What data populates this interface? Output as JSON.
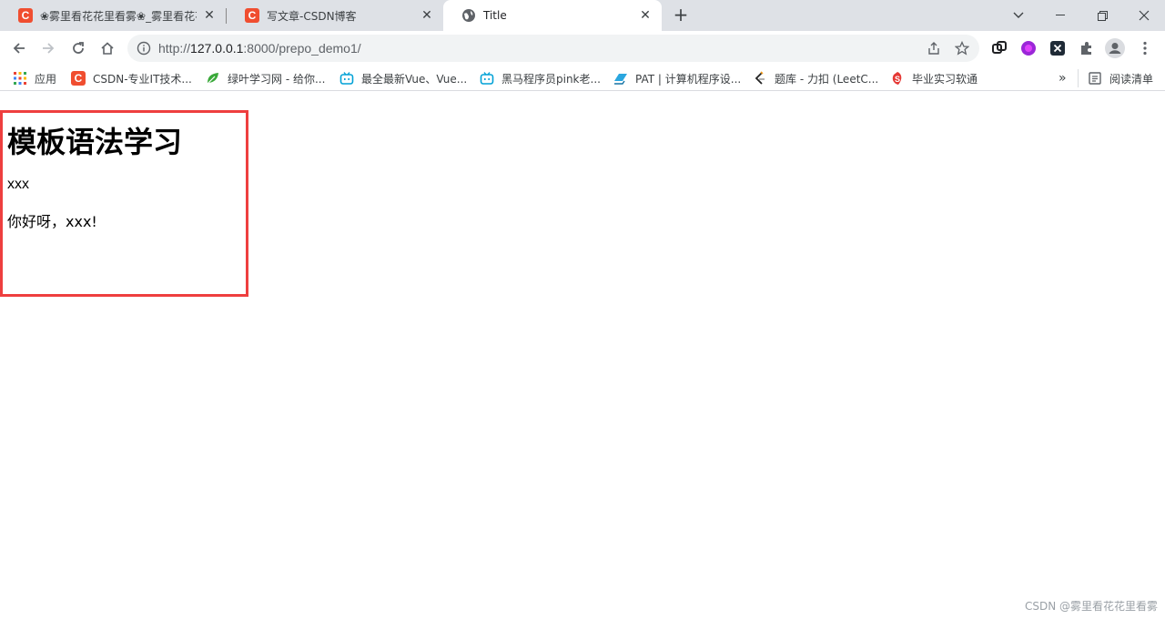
{
  "tabs": [
    {
      "title": "❀雾里看花花里看雾❀_雾里看花花",
      "favicon": "C"
    },
    {
      "title": "写文章-CSDN博客",
      "favicon": "C"
    },
    {
      "title": "Title",
      "favicon": "globe-icon"
    }
  ],
  "toolbar": {
    "url_scheme": "http://",
    "url_host": "127.0.0.1",
    "url_rest": ":8000/prepo_demo1/"
  },
  "bookmarks": {
    "items": [
      {
        "label": "应用"
      },
      {
        "label": "CSDN-专业IT技术..."
      },
      {
        "label": "绿叶学习网 - 给你..."
      },
      {
        "label": "最全最新Vue、Vue..."
      },
      {
        "label": "黑马程序员pink老..."
      },
      {
        "label": "PAT | 计算机程序设..."
      },
      {
        "label": "题库 - 力扣 (LeetC..."
      },
      {
        "label": "毕业实习软通"
      }
    ],
    "more": "»",
    "reading_list": "阅读清单"
  },
  "page": {
    "heading": "模板语法学习",
    "line1": "xxx",
    "line2": "你好呀，xxx!"
  },
  "watermark": "CSDN @雾里看花花里看雾",
  "colors": {
    "highlight": "#ee3f3f",
    "csdn": "#f04e30",
    "tabstrip": "#dee1e6"
  }
}
